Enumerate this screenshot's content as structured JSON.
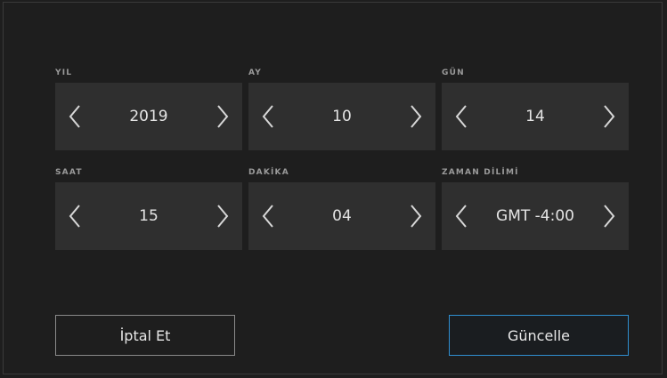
{
  "fields": [
    {
      "label": "YIL",
      "value": "2019"
    },
    {
      "label": "AY",
      "value": "10"
    },
    {
      "label": "GÜN",
      "value": "14"
    },
    {
      "label": "SAAT",
      "value": "15"
    },
    {
      "label": "DAKİKA",
      "value": "04"
    },
    {
      "label": "ZAMAN DİLİMİ",
      "value": "GMT -4:00"
    }
  ],
  "buttons": {
    "cancel_label": "İptal Et",
    "update_label": "Güncelle"
  },
  "icons": {
    "decrement": "chevron-left-icon",
    "increment": "chevron-right-icon"
  },
  "colors": {
    "background": "#1e1e1e",
    "stepper_bg": "#2f2f2f",
    "accent": "#2f8fd1"
  }
}
